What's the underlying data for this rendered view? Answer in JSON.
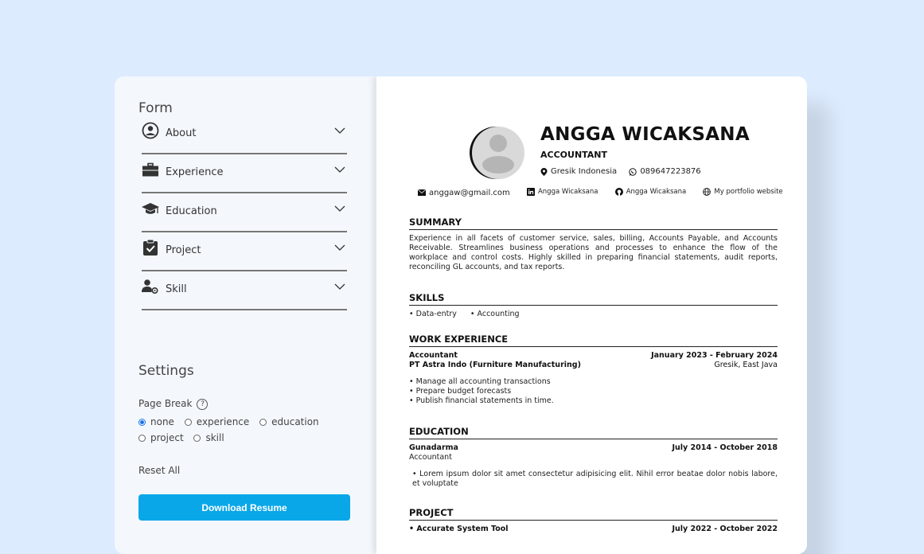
{
  "form": {
    "title": "Form",
    "sections": [
      {
        "label": "About",
        "icon": "user-circle-icon"
      },
      {
        "label": "Experience",
        "icon": "briefcase-icon"
      },
      {
        "label": "Education",
        "icon": "graduation-cap-icon"
      },
      {
        "label": "Project",
        "icon": "clipboard-check-icon"
      },
      {
        "label": "Skill",
        "icon": "user-gear-icon"
      }
    ]
  },
  "settings": {
    "title": "Settings",
    "page_break_label": "Page Break",
    "help_glyph": "?",
    "options": [
      {
        "label": "none",
        "selected": true
      },
      {
        "label": "experience",
        "selected": false
      },
      {
        "label": "education",
        "selected": false
      },
      {
        "label": "project",
        "selected": false
      },
      {
        "label": "skill",
        "selected": false
      }
    ],
    "reset_label": "Reset All",
    "download_label": "Download Resume"
  },
  "resume": {
    "name": "ANGGA WICAKSANA",
    "role": "ACCOUNTANT",
    "location": "Gresik Indonesia",
    "phone": "089647223876",
    "email": "anggaw@gmail.com",
    "linkedin": "Angga Wicaksana",
    "github": "Angga Wicaksana",
    "website": "My portfolio website",
    "summary_title": "SUMMARY",
    "summary": "Experience in all facets of customer service, sales, billing, Accounts Payable, and Accounts Receivable. Streamlines business operations and processes to enhance the flow of the workplace and control costs. Highly skilled in preparing financial statements, audit reports, reconciling GL accounts, and tax reports.",
    "skills_title": "SKILLS",
    "skills": [
      "• Data-entry",
      "• Accounting"
    ],
    "work_title": "WORK EXPERIENCE",
    "work": {
      "position": "Accountant",
      "dates": "January 2023 - February 2024",
      "company": "PT Astra Indo (Furniture Manufacturing)",
      "place": "Gresik, East Java",
      "bullets": [
        "• Manage all accounting transactions",
        "• Prepare budget forecasts",
        "• Publish financial statements in time."
      ]
    },
    "education_title": "EDUCATION",
    "education": {
      "school": "Gunadarma",
      "dates": "July 2014 - October 2018",
      "major": "Accountant",
      "desc": "• Lorem ipsum dolor sit amet consectetur adipisicing elit. Nihil error beatae dolor nobis labore, et voluptate"
    },
    "project_title": "PROJECT",
    "project": {
      "name": "• Accurate System Tool",
      "dates": "July 2022 - October 2022"
    }
  },
  "colors": {
    "background": "#dcebfd",
    "panel": "#f4f8fd",
    "accent": "#0aa7e8",
    "radio_selected": "#1a73e8"
  }
}
